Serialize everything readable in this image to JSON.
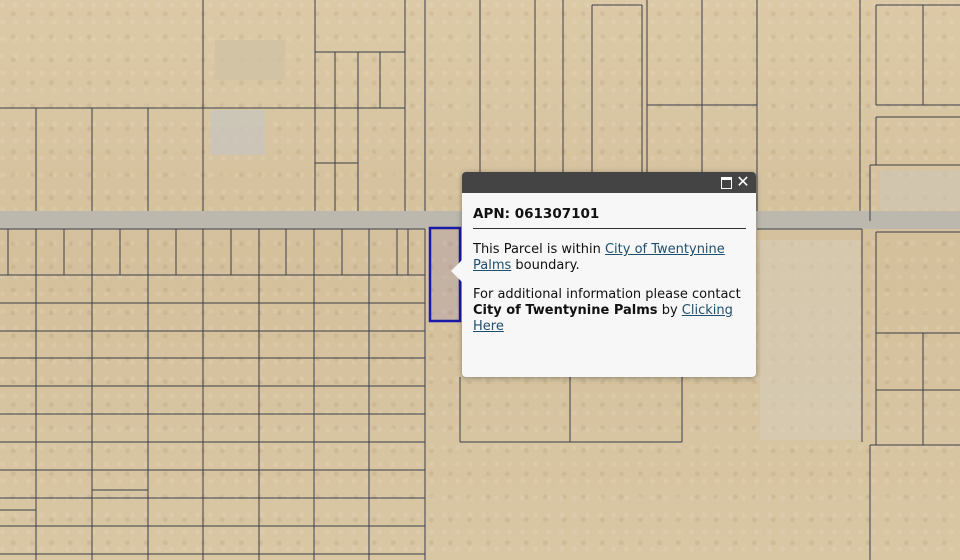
{
  "map": {
    "base_color": "#d9c6a3",
    "line_color": "#3b3f4a",
    "road_color": "#b9b6ad",
    "selection_color": "#1a1aa8"
  },
  "popup": {
    "maximize_icon": "maximize-icon",
    "close_icon": "close-icon",
    "close_glyph": "✕",
    "apn_label": "APN:",
    "apn_value": "061307101",
    "line1_prefix": "This Parcel is within",
    "line1_link": "City of Twentynine Palms",
    "line1_suffix": "boundary.",
    "line2_prefix": "For additional information please contact",
    "line2_bold": "City of Twentynine Palms",
    "line2_by": "by",
    "line2_link": "Clicking Here",
    "header_color": "#444444"
  }
}
